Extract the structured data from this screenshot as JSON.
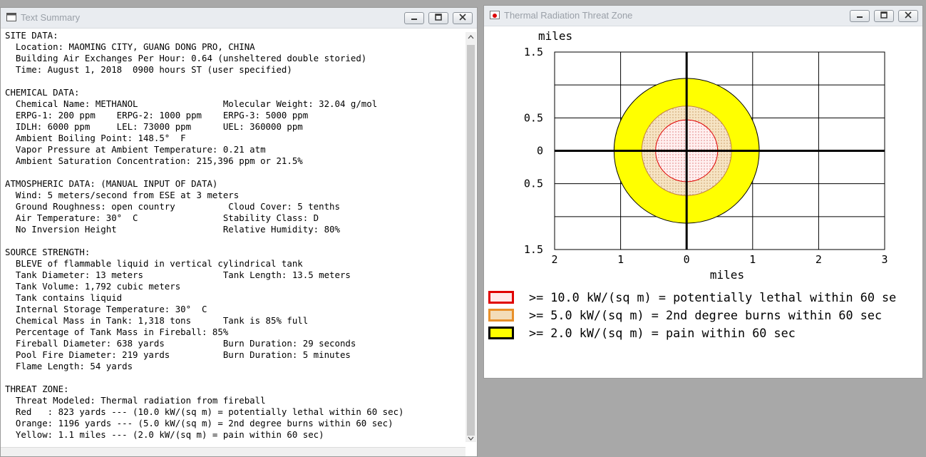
{
  "text_window": {
    "title": "Text Summary",
    "lines": [
      "SITE DATA:",
      "  Location: MAOMING CITY, GUANG DONG PRO, CHINA",
      "  Building Air Exchanges Per Hour: 0.64 (unsheltered double storied)",
      "  Time: August 1, 2018  0900 hours ST (user specified)",
      "",
      "CHEMICAL DATA:",
      "  Chemical Name: METHANOL                Molecular Weight: 32.04 g/mol",
      "  ERPG-1: 200 ppm    ERPG-2: 1000 ppm    ERPG-3: 5000 ppm",
      "  IDLH: 6000 ppm     LEL: 73000 ppm      UEL: 360000 ppm",
      "  Ambient Boiling Point: 148.5°  F",
      "  Vapor Pressure at Ambient Temperature: 0.21 atm",
      "  Ambient Saturation Concentration: 215,396 ppm or 21.5%",
      "",
      "ATMOSPHERIC DATA: (MANUAL INPUT OF DATA)",
      "  Wind: 5 meters/second from ESE at 3 meters",
      "  Ground Roughness: open country          Cloud Cover: 5 tenths",
      "  Air Temperature: 30°  C                Stability Class: D",
      "  No Inversion Height                    Relative Humidity: 80%",
      "",
      "SOURCE STRENGTH:",
      "  BLEVE of flammable liquid in vertical cylindrical tank",
      "  Tank Diameter: 13 meters               Tank Length: 13.5 meters",
      "  Tank Volume: 1,792 cubic meters",
      "  Tank contains liquid",
      "  Internal Storage Temperature: 30°  C",
      "  Chemical Mass in Tank: 1,318 tons      Tank is 85% full",
      "  Percentage of Tank Mass in Fireball: 85%",
      "  Fireball Diameter: 638 yards           Burn Duration: 29 seconds",
      "  Pool Fire Diameter: 219 yards          Burn Duration: 5 minutes",
      "  Flame Length: 54 yards",
      "",
      "THREAT ZONE:",
      "  Threat Modeled: Thermal radiation from fireball",
      "  Red   : 823 yards --- (10.0 kW/(sq m) = potentially lethal within 60 sec)",
      "  Orange: 1196 yards --- (5.0 kW/(sq m) = 2nd degree burns within 60 sec)",
      "  Yellow: 1.1 miles --- (2.0 kW/(sq m) = pain within 60 sec)"
    ]
  },
  "plot_window": {
    "title": "Thermal Radiation Threat Zone",
    "y_unit": "miles",
    "x_unit": "miles",
    "y_ticks": [
      "1.5",
      "0.5",
      "0",
      "0.5",
      "1.5"
    ],
    "x_ticks": [
      "2",
      "1",
      "0",
      "1",
      "2",
      "3"
    ],
    "xlim": [
      -2,
      3
    ],
    "ylim": [
      -1.5,
      1.5
    ],
    "zones": [
      {
        "name": "red",
        "radius_miles": 0.47,
        "fill": "#ffe4e4",
        "stroke": "#e00000"
      },
      {
        "name": "orange",
        "radius_miles": 0.68,
        "fill": "#f3dcb8",
        "stroke": "#c08040"
      },
      {
        "name": "yellow",
        "radius_miles": 1.1,
        "fill": "#ffff00",
        "stroke": "#000000"
      }
    ],
    "legend": [
      {
        "label": ">= 10.0 kW/(sq m) = potentially lethal within 60 se",
        "fill": "#ffe4e4",
        "border": "#e00000"
      },
      {
        "label": ">= 5.0 kW/(sq m) = 2nd degree burns within 60 sec",
        "fill": "#f3dcb8",
        "border": "#e8902a"
      },
      {
        "label": ">= 2.0 kW/(sq m) = pain within 60 sec",
        "fill": "#ffff00",
        "border": "#000000"
      }
    ]
  },
  "colors": {
    "titlebar": "#e9ecf0",
    "background": "#a8a8a8"
  }
}
